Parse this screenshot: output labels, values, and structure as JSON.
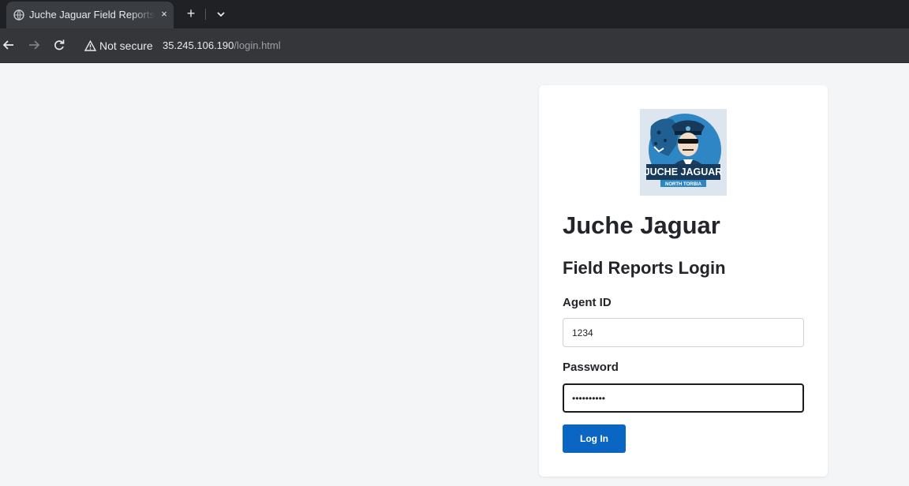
{
  "browser": {
    "tab_title": "Juche Jaguar Field Reports Login",
    "close_glyph": "×",
    "new_tab_glyph": "+",
    "security_label": "Not secure",
    "url_host": "35.245.106.190",
    "url_path": "/login.html"
  },
  "logo": {
    "wordmark": "JUCHE JAGUAR",
    "tagline": "NORTH TORBIA"
  },
  "page": {
    "title": "Juche Jaguar",
    "subtitle": "Field Reports Login"
  },
  "form": {
    "agent_id_label": "Agent ID",
    "agent_id_value": "1234",
    "password_label": "Password",
    "password_value": "secretpass",
    "submit_label": "Log In"
  },
  "colors": {
    "accent": "#0a66c2",
    "page_bg": "#f4f5f7",
    "chrome_bg": "#1f2125"
  }
}
